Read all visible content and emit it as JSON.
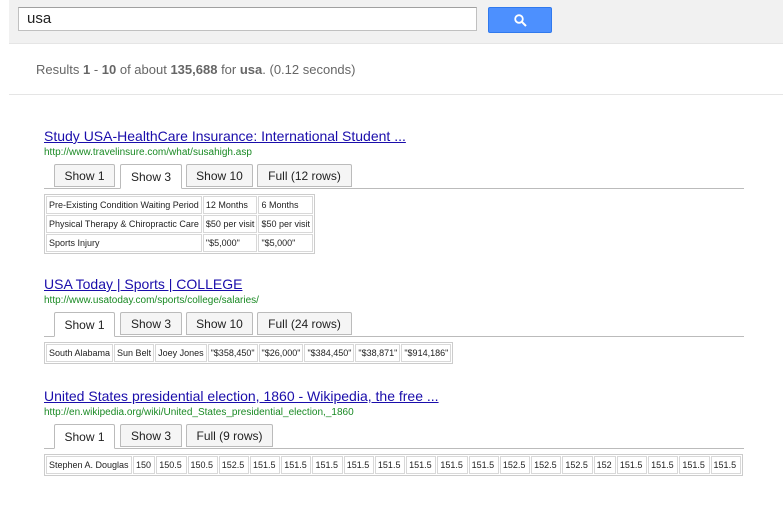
{
  "search": {
    "query": "usa",
    "button_icon": "search-icon"
  },
  "stats": {
    "prefix": "Results ",
    "range_start": "1",
    "sep": " - ",
    "range_end": "10",
    "mid": " of about ",
    "total": "135,688",
    "for": " for ",
    "term": "usa",
    "time": ". (0.12 seconds)"
  },
  "results": [
    {
      "title": "Study USA-HealthCare Insurance: International Student ...",
      "url": "http://www.travelinsure.com/what/susahigh.asp",
      "tabs": [
        "Show 1",
        "Show 3",
        "Show 10",
        "Full (12 rows)"
      ],
      "active_tab": 1,
      "rows": [
        [
          "Pre-Existing Condition Waiting Period",
          "12 Months",
          "6 Months"
        ],
        [
          "Physical Therapy & Chiropractic Care",
          "$50 per visit",
          "$50 per visit"
        ],
        [
          "Sports Injury",
          "\"$5,000\"",
          "\"$5,000\""
        ]
      ]
    },
    {
      "title": "USA Today | Sports | COLLEGE",
      "url": "http://www.usatoday.com/sports/college/salaries/",
      "tabs": [
        "Show 1",
        "Show 3",
        "Show 10",
        "Full (24 rows)"
      ],
      "active_tab": 0,
      "rows": [
        [
          "South Alabama",
          "Sun Belt",
          "Joey Jones",
          "\"$358,450\"",
          "\"$26,000\"",
          "\"$384,450\"",
          "\"$38,871\"",
          "\"$914,186\""
        ]
      ]
    },
    {
      "title": "United States presidential election, 1860 - Wikipedia, the free ...",
      "url": "http://en.wikipedia.org/wiki/United_States_presidential_election,_1860",
      "tabs": [
        "Show 1",
        "Show 3",
        "Full (9 rows)"
      ],
      "active_tab": 0,
      "rows": [
        [
          "Stephen A. Douglas",
          "150",
          "150.5",
          "150.5",
          "152.5",
          "151.5",
          "151.5",
          "151.5",
          "151.5",
          "151.5",
          "151.5",
          "151.5",
          "151.5",
          "152.5",
          "152.5",
          "152.5",
          "152",
          "151.5",
          "151.5",
          "151.5",
          "151.5"
        ]
      ]
    }
  ]
}
